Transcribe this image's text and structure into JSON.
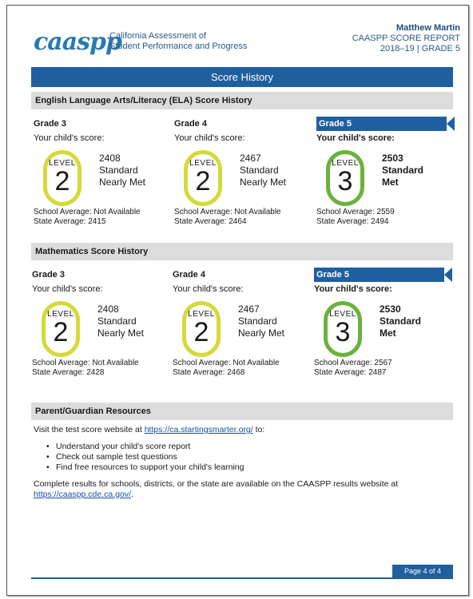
{
  "header": {
    "logo_text": "caaspp",
    "org_line1": "California Assessment of",
    "org_line2": "Student Performance and Progress",
    "student_name": "Matthew Martin",
    "report_title": "CAASPP SCORE REPORT",
    "year_grade": "2018–19 | GRADE 5"
  },
  "banner": "Score History",
  "ela": {
    "title": "English Language Arts/Literacy (ELA) Score History",
    "columns": [
      {
        "grade": "Grade 3",
        "label": "Your child's score:",
        "level_word": "LEVEL",
        "level": "2",
        "score": "2408",
        "status1": "Standard",
        "status2": "Nearly Met",
        "school_avg": "School Average: Not Available",
        "state_avg": "State Average: 2415"
      },
      {
        "grade": "Grade 4",
        "label": "Your child's score:",
        "level_word": "LEVEL",
        "level": "2",
        "score": "2467",
        "status1": "Standard",
        "status2": "Nearly Met",
        "school_avg": "School Average: Not Available",
        "state_avg": "State Average: 2464"
      },
      {
        "grade": "Grade 5",
        "label": "Your child's score:",
        "level_word": "LEVEL",
        "level": "3",
        "score": "2503",
        "status1": "Standard",
        "status2": "Met",
        "school_avg": "School Average: 2559",
        "state_avg": "State Average: 2494"
      }
    ]
  },
  "math": {
    "title": "Mathematics Score History",
    "columns": [
      {
        "grade": "Grade 3",
        "label": "Your child's score:",
        "level_word": "LEVEL",
        "level": "2",
        "score": "2408",
        "status1": "Standard",
        "status2": "Nearly Met",
        "school_avg": "School Average: Not Available",
        "state_avg": "State Average: 2428"
      },
      {
        "grade": "Grade 4",
        "label": "Your child's score:",
        "level_word": "LEVEL",
        "level": "2",
        "score": "2467",
        "status1": "Standard",
        "status2": "Nearly Met",
        "school_avg": "School Average: Not Available",
        "state_avg": "State Average: 2468"
      },
      {
        "grade": "Grade 5",
        "label": "Your child's score:",
        "level_word": "LEVEL",
        "level": "3",
        "score": "2530",
        "status1": "Standard",
        "status2": "Met",
        "school_avg": "School Average: 2567",
        "state_avg": "State Average: 2487"
      }
    ]
  },
  "resources": {
    "title": "Parent/Guardian Resources",
    "intro_prefix": "Visit the test score website at ",
    "intro_link": "https://ca.startingsmarter.org/",
    "intro_suffix": " to:",
    "bullets": [
      "Understand your child's score report",
      "Check out sample test questions",
      "Find free resources to support your child's learning"
    ],
    "closing_text": "Complete results for schools, districts, or the state are available on the CAASPP results website at",
    "closing_link": "https://caaspp.cde.ca.gov/",
    "closing_suffix": "."
  },
  "footer": {
    "page": "Page 4 of 4"
  },
  "colors": {
    "brand_blue": "#1f5fa0",
    "level2_ring": "#d4da3a",
    "level3_ring": "#6ab23e",
    "section_gray": "#dcdcdc"
  }
}
